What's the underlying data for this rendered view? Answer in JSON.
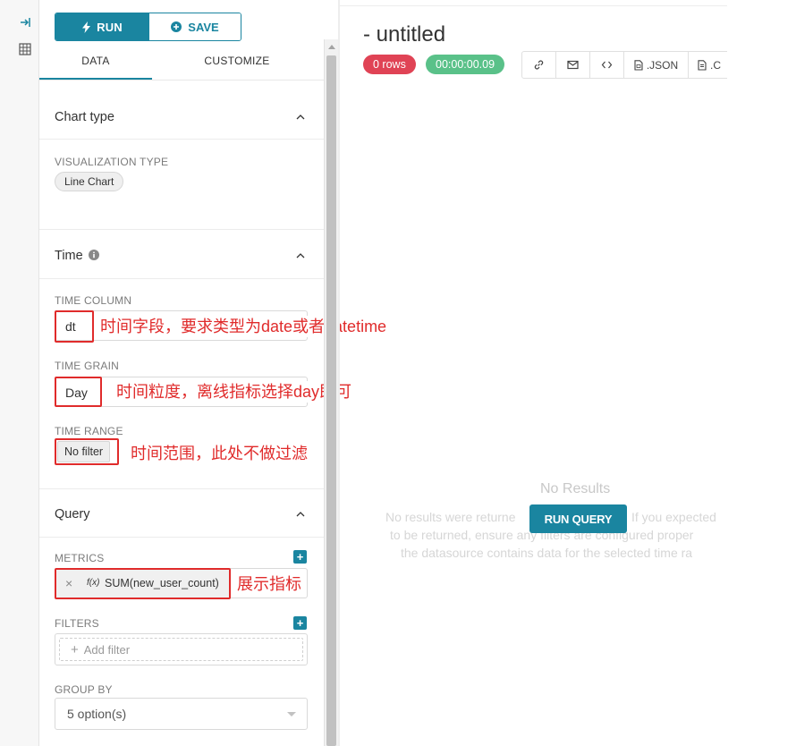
{
  "toolbar": {
    "run_label": "RUN",
    "save_label": "SAVE"
  },
  "tabs": [
    "DATA",
    "CUSTOMIZE"
  ],
  "sections": {
    "chart_type": {
      "title": "Chart type",
      "vis_label": "VISUALIZATION TYPE",
      "vis_value": "Line Chart"
    },
    "time": {
      "title": "Time",
      "column_label": "TIME COLUMN",
      "column_value": "dt",
      "column_note": "时间字段，要求类型为date或者datetime",
      "grain_label": "TIME GRAIN",
      "grain_value": "Day",
      "grain_note": "时间粒度，离线指标选择day即可",
      "range_label": "TIME RANGE",
      "range_value": "No filter",
      "range_note": "时间范围，此处不做过滤"
    },
    "query": {
      "title": "Query",
      "metrics_label": "METRICS",
      "metric_fx": "f(x)",
      "metric_value": "SUM(new_user_count)",
      "metric_note": "展示指标",
      "filters_label": "FILTERS",
      "add_filter": "Add filter",
      "groupby_label": "GROUP BY",
      "groupby_value": "5 option(s)"
    }
  },
  "main": {
    "title": "- untitled",
    "rows_badge": "0 rows",
    "time_badge": "00:00:00.09",
    "json_label": ".JSON",
    "csv_label": ".C",
    "no_results_title": "No Results",
    "no_results_line1_left": "No results were returne",
    "no_results_line1_right": "If you expected",
    "no_results_line2": "to be returned, ensure any filters are configured proper",
    "no_results_line3": "the datasource contains data for the selected time ra",
    "run_query_label": "RUN QUERY"
  },
  "colors": {
    "primary": "#1a85a0",
    "danger": "#e04355",
    "success": "#5ac189",
    "annotation": "#e02b2b"
  }
}
